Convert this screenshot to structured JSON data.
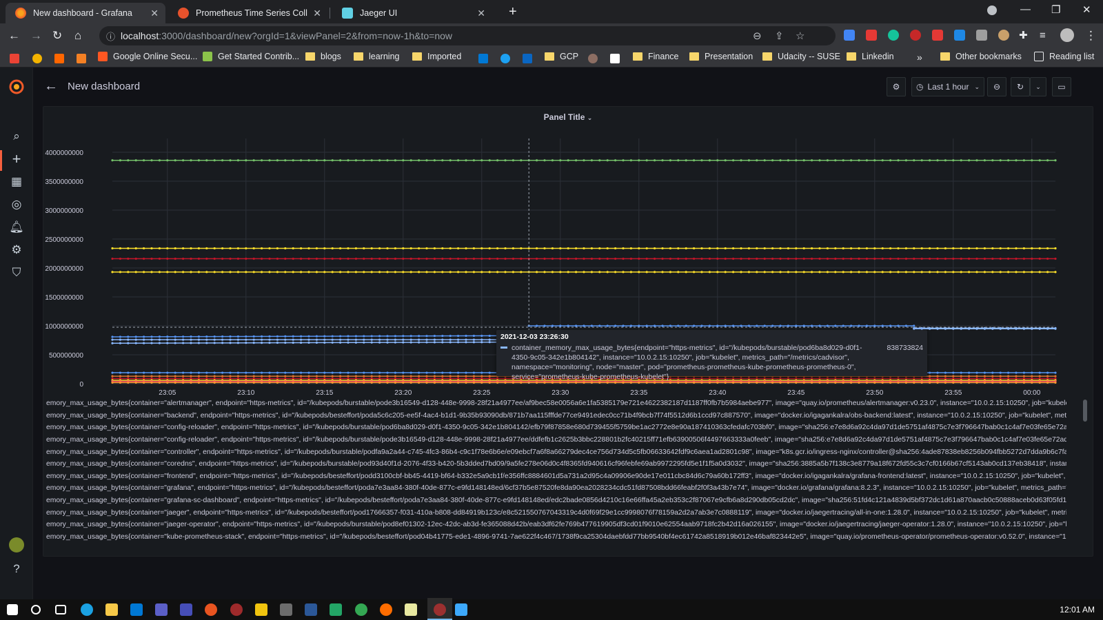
{
  "browser": {
    "tabs": [
      {
        "title": "New dashboard - Grafana",
        "active": true
      },
      {
        "title": "Prometheus Time Series Collecti",
        "active": false
      },
      {
        "title": "Jaeger UI",
        "active": false
      }
    ],
    "url_host": "localhost",
    "url_path": ":3000/dashboard/new?orgId=1&viewPanel=2&from=now-1h&to=now",
    "bookmarks": [
      "Google Online Secu...",
      "Get Started Contrib...",
      "blogs",
      "learning",
      "Imported",
      "GCP",
      "Finance",
      "Presentation",
      "Udacity -- SUSE",
      "Linkedin"
    ],
    "other_bookmarks": "Other bookmarks",
    "reading_list": "Reading list"
  },
  "grafana": {
    "page_title": "New dashboard",
    "time_range_label": "Last 1 hour",
    "panel_title": "Panel Title"
  },
  "chart_data": {
    "type": "line",
    "xlabel": "",
    "ylabel": "",
    "grid": true,
    "y_ticks": [
      "0",
      "500000000",
      "1000000000",
      "1500000000",
      "2000000000",
      "2500000000",
      "3000000000",
      "3500000000",
      "4000000000"
    ],
    "x_ticks": [
      "23:05",
      "23:10",
      "23:15",
      "23:20",
      "23:25",
      "23:30",
      "23:35",
      "23:40",
      "23:45",
      "23:50",
      "23:55",
      "00:00"
    ],
    "ylim": [
      0,
      4000000000
    ],
    "x_range_minutes": [
      0,
      60
    ],
    "legend_position": "bottom",
    "series": [
      {
        "color": "#73bf69",
        "segments": [
          {
            "x": [
              0,
              60
            ],
            "y": [
              3860000000,
              3860000000
            ]
          }
        ]
      },
      {
        "color": "#fade2a",
        "segments": [
          {
            "x": [
              0,
              60
            ],
            "y": [
              2340000000,
              2340000000
            ]
          }
        ]
      },
      {
        "color": "#c4162a",
        "segments": [
          {
            "x": [
              0,
              60
            ],
            "y": [
              2160000000,
              2160000000
            ]
          }
        ]
      },
      {
        "color": "#fade2a",
        "segments": [
          {
            "x": [
              0,
              60
            ],
            "y": [
              1930000000,
              1930000000
            ]
          }
        ]
      },
      {
        "color": "#5794f2",
        "segments": [
          {
            "x": [
              0,
              26.5
            ],
            "y": [
              810000000,
              830000000
            ]
          },
          {
            "x": [
              26.5,
              51
            ],
            "y": [
              1000000000,
              1000000000
            ]
          }
        ]
      },
      {
        "color": "#8ab8ff",
        "segments": [
          {
            "x": [
              0,
              26.5
            ],
            "y": [
              760000000,
              760000000
            ]
          },
          {
            "x": [
              51,
              60
            ],
            "y": [
              960000000,
              960000000
            ]
          }
        ]
      },
      {
        "color": "#8ab8ff",
        "segments": [
          {
            "x": [
              0,
              26.5
            ],
            "y": [
              700000000,
              720000000
            ]
          },
          {
            "x": [
              51,
              60
            ],
            "y": [
              950000000,
              950000000
            ]
          }
        ]
      },
      {
        "color": "#5794f2",
        "segments": [
          {
            "x": [
              0,
              60
            ],
            "y": [
              190000000,
              190000000
            ]
          }
        ]
      },
      {
        "color": "#e0752d",
        "segments": [
          {
            "x": [
              0,
              60
            ],
            "y": [
              130000000,
              130000000
            ]
          }
        ]
      },
      {
        "color": "#c4162a",
        "segments": [
          {
            "x": [
              0,
              60
            ],
            "y": [
              90000000,
              90000000
            ]
          }
        ]
      },
      {
        "color": "#fade2a",
        "segments": [
          {
            "x": [
              0,
              60
            ],
            "y": [
              60000000,
              60000000
            ]
          }
        ]
      },
      {
        "color": "#f2495c",
        "segments": [
          {
            "x": [
              0,
              60
            ],
            "y": [
              40000000,
              40000000
            ]
          }
        ]
      },
      {
        "color": "#ff9830",
        "segments": [
          {
            "x": [
              0,
              60
            ],
            "y": [
              20000000,
              20000000
            ]
          }
        ]
      }
    ],
    "crosshair_x": 26.5,
    "tooltip": {
      "time": "2021-12-03 23:26:30",
      "label": "container_memory_max_usage_bytes{endpoint=\"https-metrics\", id=\"/kubepods/burstable/pod6ba8d029-d0f1-4350-9c05-342e1b804142\", instance=\"10.0.2.15:10250\", job=\"kubelet\", metrics_path=\"/metrics/cadvisor\", namespace=\"monitoring\", node=\"master\", pod=\"prometheus-prometheus-kube-prometheus-prometheus-0\", service=\"prometheus-kube-prometheus-kubelet\"}",
      "value": "838733824"
    },
    "legend": [
      {
        "color": "#73bf69",
        "label": "emory_max_usage_bytes{container=\"alertmanager\", endpoint=\"https-metrics\", id=\"/kubepods/burstable/pode3b16549-d128-448e-9998-28f21a4977ee/af9bec58e0056a6e1fa5385179e721e4622382187d1187ff0fb7b5984aebe977\", image=\"quay.io/prometheus/alertmanager:v0.23.0\", instance=\"10.0.2.15:10250\", job=\"kubelet\", metrics_path=\"/metri"
      },
      {
        "color": "#fade2a",
        "label": "emory_max_usage_bytes{container=\"backend\", endpoint=\"https-metrics\", id=\"/kubepods/besteffort/poda5c6c205-ee5f-4ac4-b1d1-9b35b93090db/871b7aa115fffde77ce9491edec0cc71b4f9bcb7f74f5512d6b1ccd97c887570\", image=\"docker.io/igagankalra/obs-backend:latest\", instance=\"10.0.2.15:10250\", job=\"kubelet\", metrics_path=\"/metrics/ca"
      },
      {
        "color": "#5794f2",
        "label": "emory_max_usage_bytes{container=\"config-reloader\", endpoint=\"https-metrics\", id=\"/kubepods/burstable/pod6ba8d029-d0f1-4350-9c05-342e1b804142/efb79f87858e680d739455f5759be1ac2772e8e90a187410363cfedafc703bf0\", image=\"sha256:e7e8d6a92c4da97d1de5751af4875c7e3f796647bab0c1c4af7e03fe65e72adf\", instance=\"10.0.2.15"
      },
      {
        "color": "#ff9830",
        "label": "emory_max_usage_bytes{container=\"config-reloader\", endpoint=\"https-metrics\", id=\"/kubepods/burstable/pode3b16549-d128-448e-9998-28f21a4977ee/ddfefb1c2625b3bbc228801b2fc40215ff71efb63900506f4497663333a0feeb\", image=\"sha256:e7e8d6a92c4da97d1de5751af4875c7e3f796647bab0c1c4af7e03fe65e72adf\", instance=\"10.0.2.15:"
      },
      {
        "color": "#c4162a",
        "label": "emory_max_usage_bytes{container=\"controller\", endpoint=\"https-metrics\", id=\"/kubepods/burstable/podfa9a2a44-c745-4fc3-86b4-c9c1f78e6b6e/e09ebcf7a6f8a66279dec4ce756d734d5c5fb06633642fdf9c6aea1ad2801c98\", image=\"k8s.gcr.io/ingress-nginx/controller@sha256:4ade87838eb8256b094fbb5272d7dda9b6c7fa8b759e6af5383c1300"
      },
      {
        "color": "#8ab8ff",
        "label": "emory_max_usage_bytes{container=\"coredns\", endpoint=\"https-metrics\", id=\"/kubepods/burstable/pod93d40f1d-2076-4f33-b420-5b3dded7bd09/9a5fe278e06d0c4f8365fd940616cf96febfe69ab9972295fd5e1f1f5a0d3032\", image=\"sha256:3885a5b7f138c3e8779a18f672fd55c3c7cf0166b67cf5143ab0cd137eb38418\", instance=\"10.0.2.15:10250\","
      },
      {
        "color": "#f2495c",
        "label": "emory_max_usage_bytes{container=\"frontend\", endpoint=\"https-metrics\", id=\"/kubepods/besteffort/podd3100cbf-bb45-4419-bf64-b332e5a9cb1f/e356ffc8884601d5a731a2d95c4a09906e90de17e011cbc84d6c79a60b172ff3\", image=\"docker.io/igagankalra/grafana-frontend:latest\", instance=\"10.0.2.15:10250\", job=\"kubelet\", metrics_path=\"/metric"
      },
      {
        "color": "#fade2a",
        "label": "emory_max_usage_bytes{container=\"grafana\", endpoint=\"https-metrics\", id=\"/kubepods/besteffort/poda7e3aa84-380f-40de-877c-e9fd148148ed/6cf37b5e87520fe8da90ea2028234cdc51fd87508bdd66feabf2f0f3a43b7e74\", image=\"docker.io/grafana/grafana:8.2.3\", instance=\"10.0.2.15:10250\", job=\"kubelet\", metrics_path=\"/metrics/cadvisor\", nam"
      },
      {
        "color": "#e0752d",
        "label": "emory_max_usage_bytes{container=\"grafana-sc-dashboard\", endpoint=\"https-metrics\", id=\"/kubepods/besteffort/poda7e3aa84-380f-40de-877c-e9fd148148ed/edc2bade0856d4210c16e66ffa45a2eb353c2f87067e9cfb6a8d290db05cd2dc\", image=\"sha256:51fd4c121a4839d5bf372dc1d61a870aacb0c50888aceb0d63f05fd15718af54\", instance=\"10"
      },
      {
        "color": "#73bf69",
        "label": "emory_max_usage_bytes{container=\"jaeger\", endpoint=\"https-metrics\", id=\"/kubepods/besteffort/pod17666357-f031-410a-b808-dd84919b123c/e8c521550767043319c4d0f69f29e1cc9998076f78159a2d2a7ab3e7c0888119\", image=\"docker.io/jaegertracing/all-in-one:1.28.0\", instance=\"10.0.2.15:10250\", job=\"kubelet\", metrics_path=\"/metrics/cadv"
      },
      {
        "color": "#5794f2",
        "label": "emory_max_usage_bytes{container=\"jaeger-operator\", endpoint=\"https-metrics\", id=\"/kubepods/burstable/pod8ef01302-12ec-42dc-ab3d-fe365088d42b/eab3df62fe769b477619905df3cd01f9010e62554aab9718fc2b42d16a026155\", image=\"docker.io/jaegertracing/jaeger-operator:1.28.0\", instance=\"10.0.2.15:10250\", job=\"kubelet\", metrics_path=\"/"
      },
      {
        "color": "#ff9830",
        "label": "emory_max_usage_bytes{container=\"kube-prometheus-stack\", endpoint=\"https-metrics\", id=\"/kubepods/besteffort/pod04b41775-ede1-4896-9741-7ae622f4c467/1738f9ca25304daebfdd77bb9540bf4ec61742a8518919b012e46baf823442e5\", image=\"quay.io/prometheus-operator/prometheus-operator:v0.52.0\", instance=\"10.0.2.15:10250\", job=\"ku"
      }
    ]
  },
  "taskbar": {
    "clock": "12:01 AM"
  }
}
